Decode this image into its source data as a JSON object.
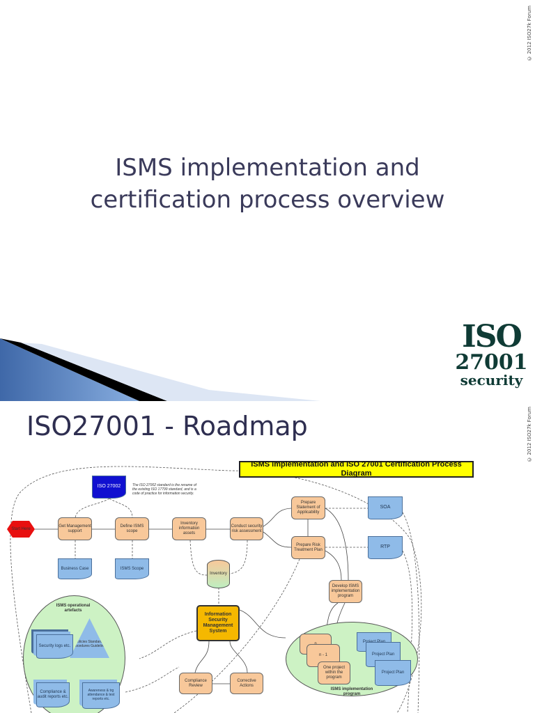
{
  "slide1": {
    "copyright": "© 2012 ISO27k Forum",
    "title_line1": "ISMS implementation and",
    "title_line2": "certification process overview",
    "logo": {
      "line1": "ISO",
      "line2": "27001",
      "line3": "security"
    }
  },
  "slide2": {
    "copyright": "© 2012 ISO27k Forum",
    "title": "ISO27001 - Roadmap",
    "diagram": {
      "title": "ISMS implementation and ISO 27001 Certification Process Diagram",
      "iso27002": "ISO 27002",
      "note": "The ISO 27002 standard is the rename of the existing ISO 17799 standard, and is a code of practice for information security.",
      "start": "Start Here",
      "get_mgmt": "Get Management support",
      "define_scope": "Define ISMS scope",
      "inventory_assets": "Inventory information assets",
      "risk_assessment": "Conduct security risk assessment",
      "prepare_soa": "Prepare Statement of Applicability",
      "prepare_rtp": "Prepare Risk Treatment Plan",
      "soa": "SOA",
      "rtp": "RTP",
      "business_case": "Business Case",
      "isms_scope": "ISMS Scope",
      "inventory": "Inventory",
      "develop_program": "Develop ISMS implementation program",
      "isms": "Information Security Management System",
      "artefacts_label": "ISMS operational artefacts",
      "security_logs": "Security logs etc.",
      "policies": "Policies Standards Procedures Guidelines",
      "compliance_reports": "Compliance & audit reports etc.",
      "awareness": "Awareness & trg attendance & test reports etc.",
      "compliance_review": "Compliance Review",
      "corrective_actions": "Corrective Actions",
      "program_label": "ISMS implementation program",
      "project_n": "n",
      "project_n1": "n - 1",
      "one_project": "One project within the program",
      "project_plan": "Project Plan"
    }
  }
}
